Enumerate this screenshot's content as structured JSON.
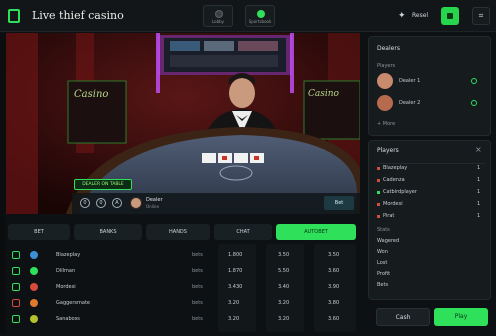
{
  "header": {
    "title": "Live thief casino",
    "tabs": [
      {
        "label": "Lobby",
        "icon": "casino-icon",
        "color": "#3b4045"
      },
      {
        "label": "Sportsbook",
        "icon": "football-icon",
        "color": "#2fe05a"
      }
    ],
    "status_text": "Resel",
    "accent": "#2fe05a"
  },
  "stream": {
    "overlay_badge": "DEALER ON TABLE",
    "chip_values": [
      "0",
      "0",
      "A"
    ],
    "dealer_name": "Dealer",
    "dealer_sub": "Online",
    "action_button": "Bet",
    "table_sign_left": "Casino",
    "table_sign_right": "Casino"
  },
  "main_tabs": [
    {
      "label": "BET",
      "active": false
    },
    {
      "label": "BANKS",
      "active": false
    },
    {
      "label": "HANDS",
      "active": false
    },
    {
      "label": "CHAT",
      "active": false
    },
    {
      "label": "AUTOBET",
      "active": true
    }
  ],
  "table": {
    "rows": [
      {
        "player": "Blazeplay",
        "tag": "bets",
        "c1": "1.800",
        "c2": "3.50",
        "c3": "3.50"
      },
      {
        "player": "Dillman",
        "tag": "bets",
        "c1": "1.870",
        "c2": "5.50",
        "c3": "3.60"
      },
      {
        "player": "Mordesi",
        "tag": "bets",
        "c1": "3.430",
        "c2": "3.40",
        "c3": "3.90"
      },
      {
        "player": "Gaggersmate",
        "tag": "bets",
        "c1": "3.20",
        "c2": "3.20",
        "c3": "3.80"
      },
      {
        "player": "Sanaboss",
        "tag": "bets",
        "c1": "3.20",
        "c2": "3.20",
        "c3": "3.60"
      }
    ]
  },
  "side_players": {
    "title": "Dealers",
    "section": "Players",
    "items": [
      {
        "name": "Dealer 1"
      },
      {
        "name": "Dealer 2"
      }
    ],
    "footer": "+ More"
  },
  "side_history": {
    "title": "Players",
    "items": [
      {
        "name": "Blazeplay",
        "val": "1"
      },
      {
        "name": "Cadenza",
        "val": "1"
      },
      {
        "name": "Catbirdplayer",
        "val": "1"
      },
      {
        "name": "Mordesi",
        "val": "1"
      },
      {
        "name": "Pirat",
        "val": "1"
      }
    ],
    "sub_title": "Stats",
    "sub_items": [
      "Wagered",
      "Won",
      "Lost",
      "Profit",
      "Bets"
    ]
  },
  "footer_buttons": {
    "left": "Cash",
    "right": "Play"
  }
}
